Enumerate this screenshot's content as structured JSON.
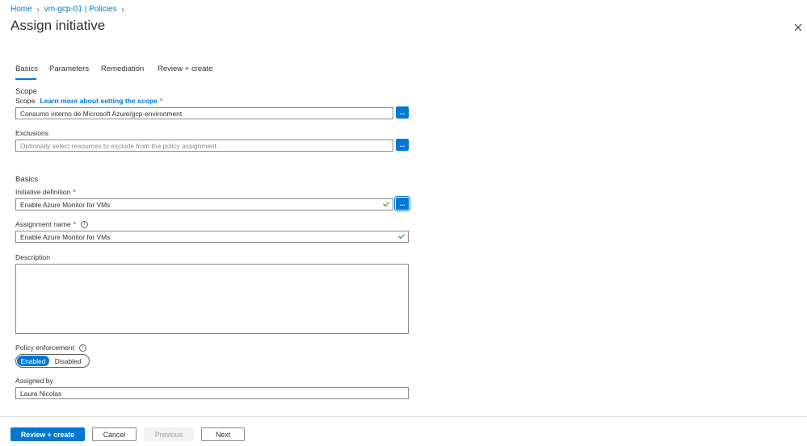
{
  "breadcrumb": {
    "home": "Home",
    "resource": "vm-gcp-01 | Policies"
  },
  "header": {
    "title": "Assign initiative"
  },
  "tabs": [
    {
      "label": "Basics",
      "active": true
    },
    {
      "label": "Parameters",
      "active": false
    },
    {
      "label": "Remediation",
      "active": false
    },
    {
      "label": "Review + create",
      "active": false
    }
  ],
  "scope_section": {
    "heading": "Scope",
    "scope_label": "Scope",
    "scope_link": "Learn more about setting the scope",
    "required_mark": "*",
    "scope_value": "Consumo interno de Microsoft Azure/gcp-environment",
    "exclusions_label": "Exclusions",
    "exclusions_placeholder": "Optionally select resources to exclude from the policy assignment.",
    "browse_button": "..."
  },
  "basics_section": {
    "heading": "Basics",
    "initiative_label": "Initiative definition",
    "initiative_value": "Enable Azure Monitor for VMs",
    "assignment_name_label": "Assignment name",
    "assignment_name_value": "Enable Azure Monitor for VMs",
    "description_label": "Description",
    "description_value": "",
    "policy_enforcement_label": "Policy enforcement",
    "enforcement_enabled": "Enabled",
    "enforcement_disabled": "Disabled",
    "enforcement_selected": "Enabled",
    "assigned_by_label": "Assigned by",
    "assigned_by_value": "Laura Nicolas",
    "info_glyph": "i"
  },
  "footer": {
    "review_create": "Review + create",
    "cancel": "Cancel",
    "previous": "Previous",
    "next": "Next"
  },
  "colors": {
    "accent": "#0078d4",
    "success": "#107c10",
    "required": "#a4262c"
  }
}
